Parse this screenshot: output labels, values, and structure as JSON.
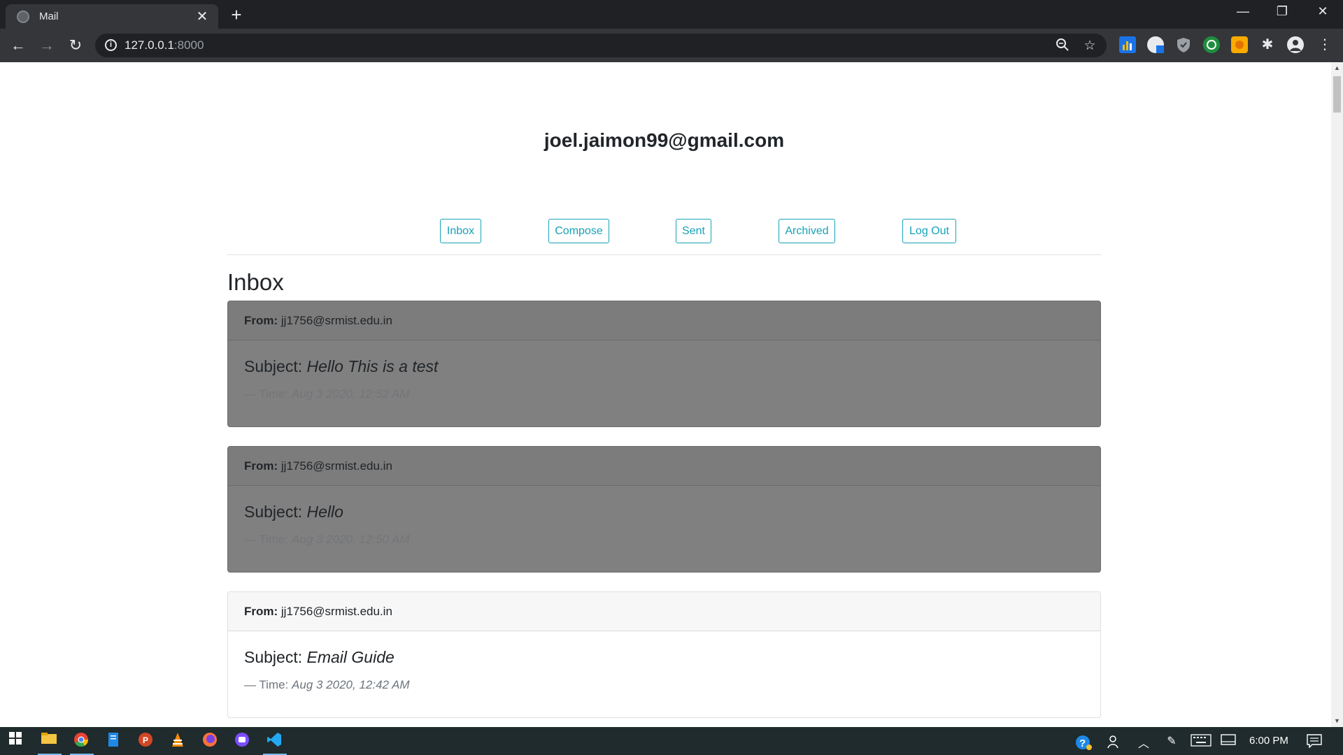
{
  "browser": {
    "tab_title": "Mail",
    "tab_close": "✕",
    "new_tab": "+",
    "url_host": "127.0.0.1",
    "url_port": ":8000",
    "window_controls": [
      "—",
      "❐",
      "✕"
    ]
  },
  "page": {
    "user_email": "joel.jaimon99@gmail.com",
    "nav": {
      "inbox": "Inbox",
      "compose": "Compose",
      "sent": "Sent",
      "archived": "Archived",
      "logout": "Log Out"
    },
    "heading": "Inbox",
    "emails": [
      {
        "from_label": "From:",
        "sender": "jj1756@srmist.edu.in",
        "subject_label": "Subject:",
        "subject": "Hello This is a test",
        "time_label": "— Time:",
        "time": "Aug 3 2020, 12:52 AM",
        "read": true
      },
      {
        "from_label": "From:",
        "sender": "jj1756@srmist.edu.in",
        "subject_label": "Subject:",
        "subject": "Hello",
        "time_label": "— Time:",
        "time": "Aug 3 2020, 12:50 AM",
        "read": true
      },
      {
        "from_label": "From:",
        "sender": "jj1756@srmist.edu.in",
        "subject_label": "Subject:",
        "subject": "Email Guide",
        "time_label": "— Time:",
        "time": "Aug 3 2020, 12:42 AM",
        "read": false
      }
    ]
  },
  "taskbar": {
    "clock": "6:00 PM"
  },
  "colors": {
    "accent": "#17a2b8",
    "read_card": "#808080",
    "chrome_dark": "#202124",
    "chrome_toolbar": "#35363a",
    "taskbar": "#1f2b2c"
  }
}
